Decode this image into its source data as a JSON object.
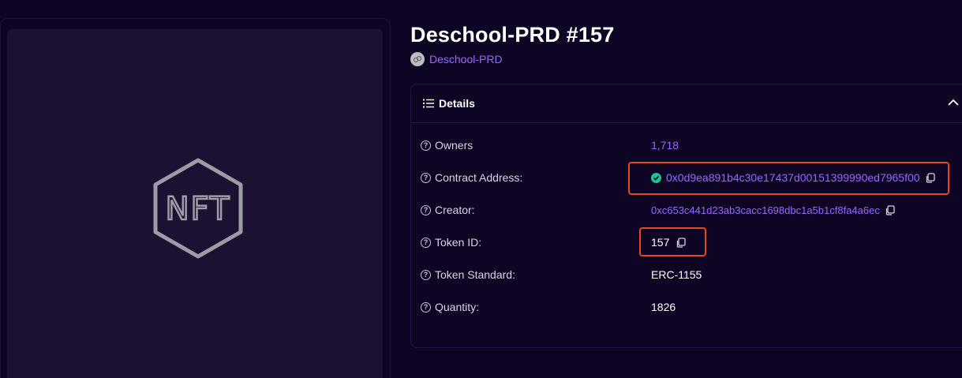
{
  "nft": {
    "title": "Deschool-PRD #157",
    "collection": "Deschool-PRD",
    "image_icon": "nft-hexagon-icon"
  },
  "details": {
    "header": "Details",
    "rows": [
      {
        "label": "Owners",
        "value": "1,718"
      },
      {
        "label": "Contract Address:",
        "value": "0x0d9ea891b4c30e17437d00151399990ed7965f00"
      },
      {
        "label": "Creator:",
        "value": "0xc653c441d23ab3cacc1698dbc1a5b1cf8fa4a6ec"
      },
      {
        "label": "Token ID:",
        "value": "157"
      },
      {
        "label": "Token Standard:",
        "value": "ERC-1155"
      },
      {
        "label": "Quantity:",
        "value": "1826"
      }
    ]
  },
  "colors": {
    "background": "#0e0423",
    "accent": "#9a67ff",
    "verified": "#1ec29b",
    "highlight": "#e8471c"
  }
}
